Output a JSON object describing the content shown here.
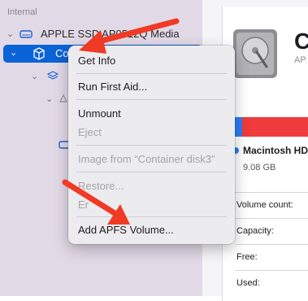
{
  "sidebar": {
    "section_label": "Internal",
    "items": [
      {
        "label": "APPLE SSD AP0512Q Media"
      },
      {
        "label": "Co"
      }
    ]
  },
  "context_menu": {
    "items": [
      {
        "label": "Get Info",
        "enabled": true
      },
      {
        "label": "Run First Aid...",
        "enabled": true
      },
      {
        "label": "Unmount",
        "enabled": true
      },
      {
        "label": "Eject",
        "enabled": false
      },
      {
        "label": "Image from “Container disk3”",
        "enabled": false
      },
      {
        "label": "Restore...",
        "enabled": false
      },
      {
        "label": "Er",
        "enabled": false
      },
      {
        "label": "Add APFS Volume...",
        "enabled": true
      }
    ]
  },
  "detail": {
    "title_fragment": "C",
    "subtitle_fragment": "AP",
    "volume_name": "Macintosh HD",
    "volume_size": "9.08 GB",
    "info_rows": [
      "Volume count:",
      "Capacity:",
      "Free:",
      "Used:"
    ]
  },
  "colors": {
    "sidebar_bg": "#e2d9e6",
    "selection": "#0b63d8",
    "usage_blue": "#2f7cf6",
    "usage_red": "#ef3b3b",
    "annotation_arrow": "#f03a24"
  }
}
